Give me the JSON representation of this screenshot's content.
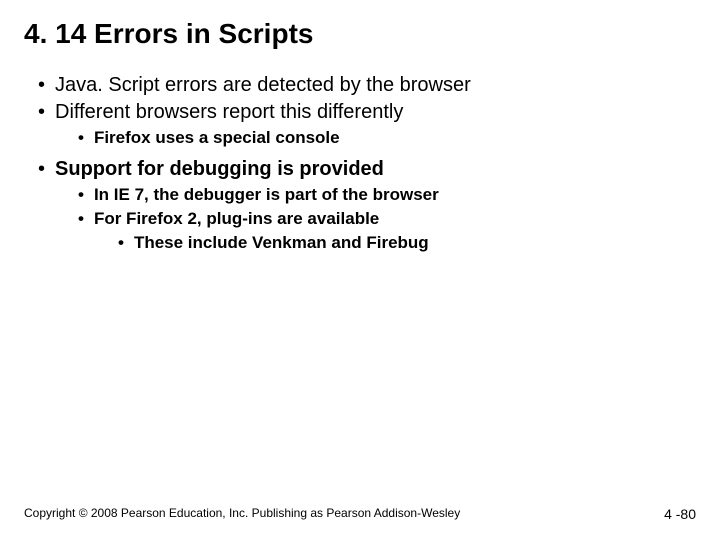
{
  "title": "4. 14 Errors in Scripts",
  "bullets": {
    "b1": "Java. Script errors are detected by the browser",
    "b2": "Different browsers report this differently",
    "b2_1": "Firefox uses a special console",
    "b3": "Support for debugging is provided",
    "b3_1": "In IE 7, the debugger is part of the browser",
    "b3_2": "For Firefox 2, plug-ins are available",
    "b3_2_1": "These include Venkman and Firebug"
  },
  "footer": {
    "copyright": "Copyright © 2008 Pearson Education, Inc. Publishing as Pearson Addison-Wesley",
    "page": "4 -80"
  }
}
